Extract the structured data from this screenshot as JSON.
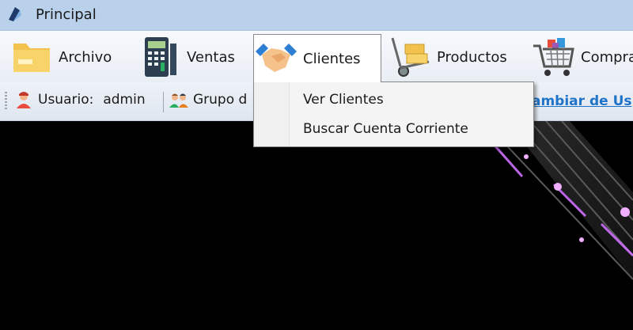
{
  "window": {
    "title": "Principal",
    "icon": "app-logo-icon"
  },
  "menu": {
    "items": [
      {
        "label": "Archivo",
        "icon": "folder-icon"
      },
      {
        "label": "Ventas",
        "icon": "cash-register-icon"
      },
      {
        "label": "Clientes",
        "icon": "handshake-icon",
        "open": true
      },
      {
        "label": "Productos",
        "icon": "hand-truck-icon"
      },
      {
        "label": "Compra",
        "icon": "shopping-cart-icon"
      }
    ]
  },
  "dropdown": {
    "items": [
      {
        "label": "Ver Clientes"
      },
      {
        "label": "Buscar Cuenta Corriente"
      }
    ]
  },
  "info": {
    "user_label": "Usuario:",
    "user_value": "admin",
    "group_label": "Grupo d",
    "change_user_link": "ambiar de Us"
  },
  "colors": {
    "titlebar": "#b9d1ea",
    "link": "#1f73c8",
    "accent_neon": "#e070ff"
  }
}
